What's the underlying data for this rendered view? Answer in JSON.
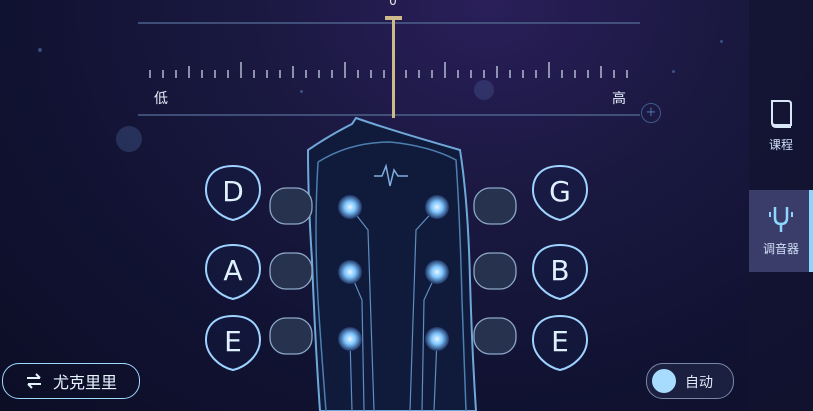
{
  "tuner": {
    "value": "0",
    "low_label": "低",
    "high_label": "高",
    "plus": "+"
  },
  "strings_left": [
    {
      "note": "D"
    },
    {
      "note": "A"
    },
    {
      "note": "E"
    }
  ],
  "strings_right": [
    {
      "note": "G"
    },
    {
      "note": "B"
    },
    {
      "note": "E"
    }
  ],
  "sidebar": {
    "items": [
      {
        "label": "课程",
        "icon": "book-icon",
        "active": false
      },
      {
        "label": "调音器",
        "icon": "tuning-fork-icon",
        "active": true
      }
    ]
  },
  "bottom": {
    "instrument_label": "尤克里里",
    "swap_icon": "swap-icon",
    "auto_label": "自动"
  },
  "colors": {
    "accent": "#8fd6ff",
    "needle": "#cdb98a"
  }
}
